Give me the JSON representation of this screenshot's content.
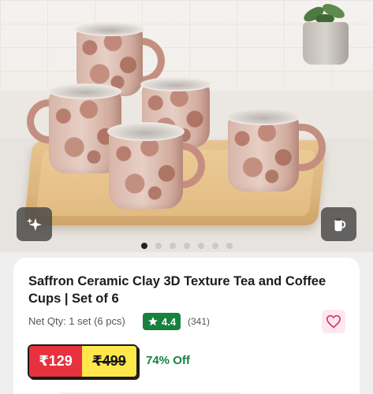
{
  "product": {
    "title": "Saffron Ceramic Clay 3D Texture Tea and Coffee Cups | Set of 6",
    "net_qty": "Net Qty: 1 set (6 pcs)",
    "rating": "4.4",
    "rating_count": "(341)",
    "price": "₹129",
    "mrp": "₹499",
    "discount": "74% Off"
  },
  "gallery": {
    "total_images": 7,
    "active_index": 0
  },
  "icons": {
    "ai_button": "sparkle-icon",
    "view_button": "mug-3d-icon",
    "rating": "star-icon",
    "wishlist": "heart-icon"
  },
  "colors": {
    "rating_bg": "#17813d",
    "price_bg": "#e8313e",
    "mrp_bg": "#ffe74c",
    "discount_text": "#19823f",
    "wishlist_bg": "#fde8ee",
    "wishlist_heart": "#d6336c"
  }
}
